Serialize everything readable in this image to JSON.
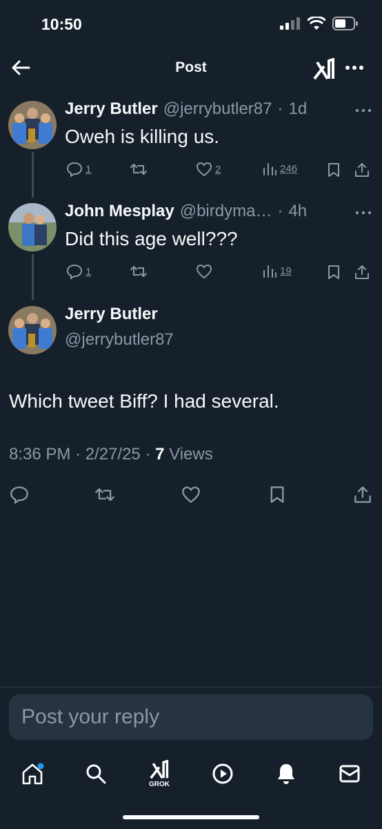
{
  "status": {
    "time": "10:50"
  },
  "header": {
    "title": "Post"
  },
  "tweets": [
    {
      "name": "Jerry Butler",
      "handle": "@jerrybutler87",
      "time": "1d",
      "text": "Oweh is killing us.",
      "replies": "1",
      "likes": "2",
      "views": "246"
    },
    {
      "name": "John Mesplay",
      "handle": "@birdyma…",
      "time": "4h",
      "text": "Did this age well???",
      "replies": "1",
      "views": "19"
    }
  ],
  "main": {
    "name": "Jerry Butler",
    "handle": "@jerrybutler87",
    "text": "Which tweet Biff? I had several.",
    "timestamp": "8:36 PM · 2/27/25 · ",
    "views_count": "7",
    "views_label": " Views"
  },
  "reply": {
    "placeholder": "Post your reply"
  },
  "nav": {
    "grok_label": "GROK"
  },
  "colors": {
    "background": "#15202b",
    "text": "#f7f9f9",
    "muted": "#8b98a5",
    "accent": "#1d9bf0"
  }
}
